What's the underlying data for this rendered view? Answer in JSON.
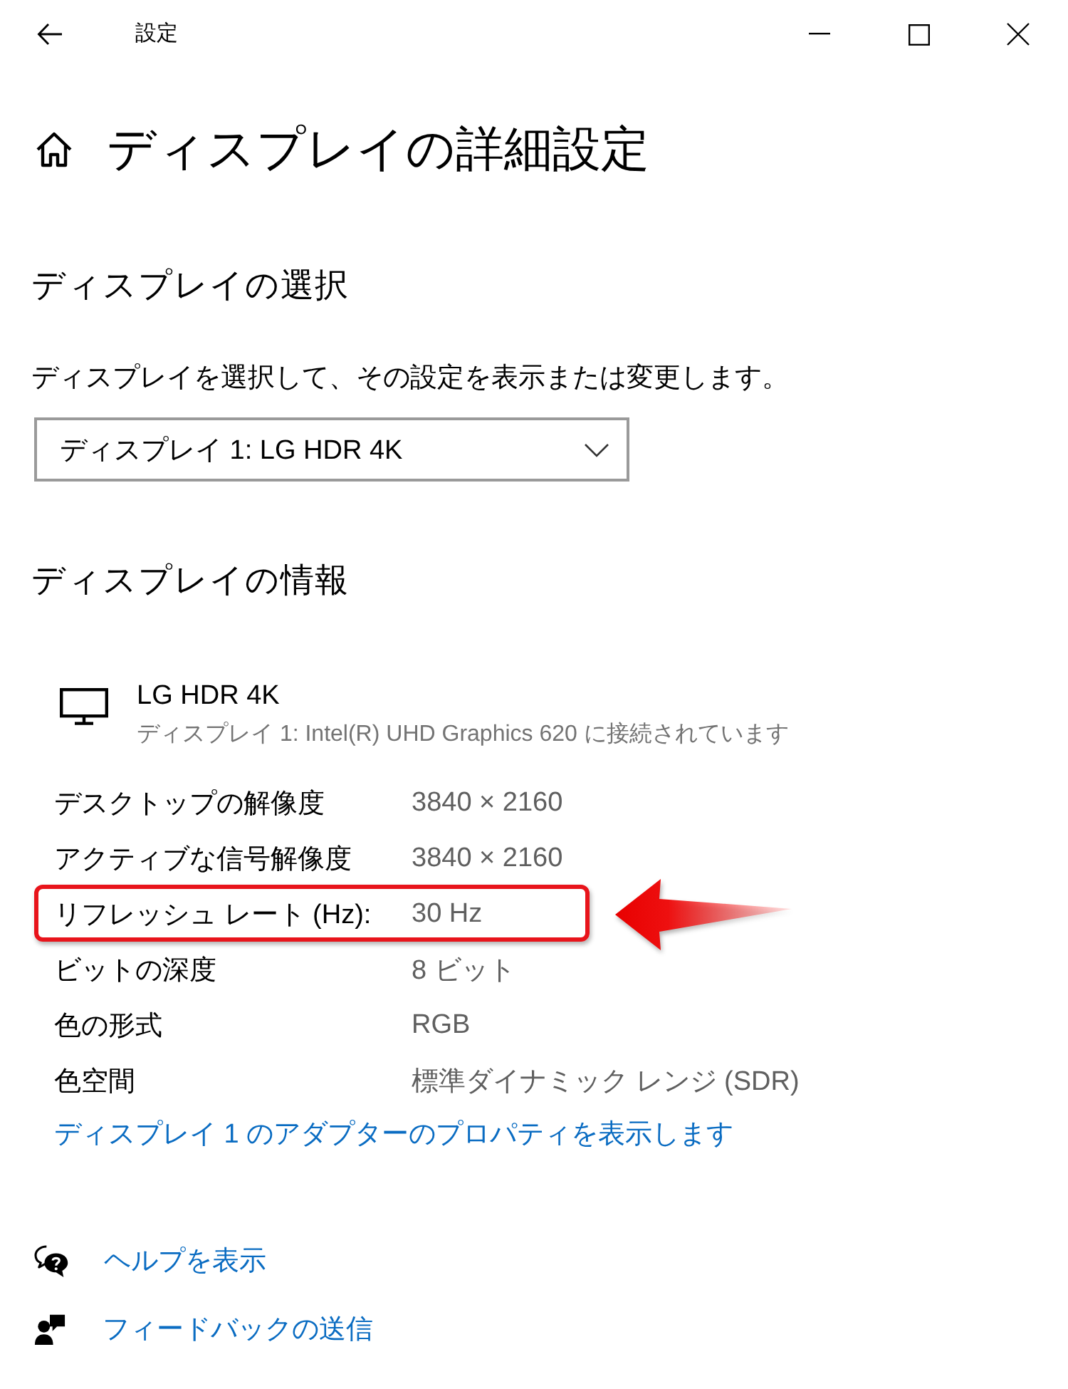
{
  "window": {
    "title": "設定"
  },
  "page": {
    "title": "ディスプレイの詳細設定"
  },
  "select_section": {
    "heading": "ディスプレイの選択",
    "description": "ディスプレイを選択して、その設定を表示または変更します。",
    "dropdown": {
      "value": "ディスプレイ 1: LG HDR 4K"
    }
  },
  "info_section": {
    "heading": "ディスプレイの情報",
    "monitor": {
      "name": "LG HDR 4K",
      "connection": "ディスプレイ 1: Intel(R) UHD Graphics 620 に接続されています"
    },
    "rows": [
      {
        "label": "デスクトップの解像度",
        "value": "3840 × 2160",
        "highlighted": false
      },
      {
        "label": "アクティブな信号解像度",
        "value": "3840 × 2160",
        "highlighted": false
      },
      {
        "label": "リフレッシュ レート (Hz):",
        "value": "30 Hz",
        "highlighted": true
      },
      {
        "label": "ビットの深度",
        "value": "8 ビット",
        "highlighted": false
      },
      {
        "label": "色の形式",
        "value": "RGB",
        "highlighted": false
      },
      {
        "label": "色空間",
        "value": "標準ダイナミック レンジ (SDR)",
        "highlighted": false
      }
    ],
    "adapter_link": "ディスプレイ 1 のアダプターのプロパティを表示します"
  },
  "footer_links": [
    {
      "kind": "help",
      "label": "ヘルプを表示"
    },
    {
      "kind": "feedback",
      "label": "フィードバックの送信"
    }
  ]
}
